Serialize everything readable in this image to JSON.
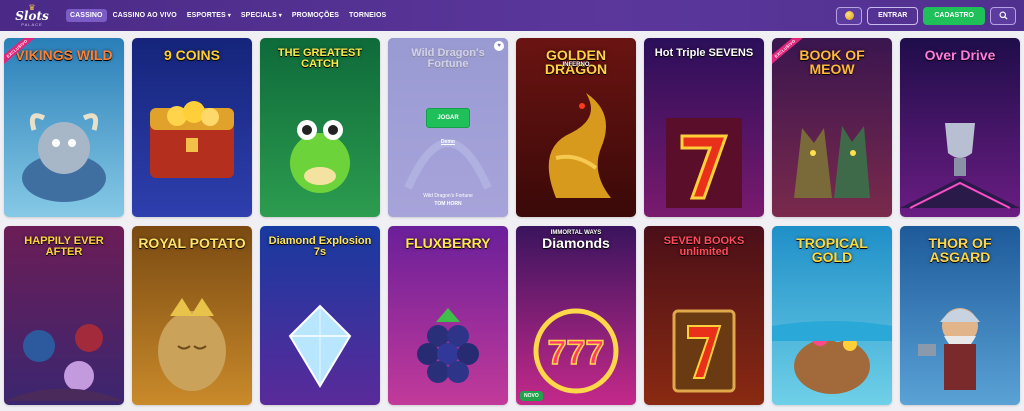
{
  "brand": {
    "name": "Slots",
    "sub": "PALACE"
  },
  "nav": [
    {
      "label": "CASSINO",
      "active": true,
      "dropdown": false
    },
    {
      "label": "CASSINO AO VIVO",
      "active": false,
      "dropdown": false
    },
    {
      "label": "ESPORTES",
      "active": false,
      "dropdown": true
    },
    {
      "label": "SPECIALS",
      "active": false,
      "dropdown": true
    },
    {
      "label": "PROMOÇÕES",
      "active": false,
      "dropdown": false
    },
    {
      "label": "TORNEIOS",
      "active": false,
      "dropdown": false
    }
  ],
  "header": {
    "login_label": "ENTRAR",
    "signup_label": "CADASTRO",
    "chevron": "▾"
  },
  "colors": {
    "accent": "#5b379c",
    "cta": "#1fbf5a",
    "badge_exclusive": "#e0267b"
  },
  "games": [
    {
      "key": "vikings",
      "title": "VIKINGS WILD",
      "title_color": "#ff7e2d",
      "badge": "EXCLUSIVO",
      "bg": [
        "#2a7fb8",
        "#86c9e6"
      ]
    },
    {
      "key": "9coins",
      "title": "9 COINS",
      "title_color": "#ffce2e",
      "badge": "",
      "bg": [
        "#15247a",
        "#2e3fae"
      ]
    },
    {
      "key": "greatest",
      "title": "THE GREATEST CATCH",
      "title_color": "#ffe94a",
      "badge": "",
      "bg": [
        "#0e6a3a",
        "#2c9c4f"
      ]
    },
    {
      "key": "dragons",
      "title": "Wild Dragon's Fortune",
      "title_color": "#ffffff",
      "badge": "",
      "bg": [
        "#3c3faf",
        "#6d60c9"
      ],
      "hover": {
        "play_label": "JOGAR",
        "demo_label": "Demo",
        "game_name": "Wild Dragon's Fortune",
        "provider": "TOM HORN"
      }
    },
    {
      "key": "golden",
      "title": "GOLDEN DRAGON",
      "subtitle": "INFERNO",
      "title_color": "#ffd24a",
      "badge": "",
      "bg": [
        "#6a1412",
        "#3a0908"
      ]
    },
    {
      "key": "sevens",
      "title": "Hot Triple SEVENS",
      "title_color": "#ffffff",
      "badge": "",
      "bg": [
        "#2b0f5a",
        "#7a1a6e"
      ]
    },
    {
      "key": "meow",
      "title": "BOOK OF MEOW",
      "title_color": "#ffb93a",
      "badge": "EXCLUSIVO",
      "bg": [
        "#3a154f",
        "#7a2a4c"
      ]
    },
    {
      "key": "overdrive",
      "title": "Over Drive",
      "title_color": "#ff7be0",
      "badge": "",
      "bg": [
        "#1f0d4a",
        "#6a1d82"
      ]
    },
    {
      "key": "happily",
      "title": "HAPPILY EVER AFTER",
      "title_color": "#ffd23f",
      "badge": "",
      "bg": [
        "#6b1d56",
        "#3b2670"
      ]
    },
    {
      "key": "potato",
      "title": "ROYAL POTATO",
      "title_color": "#ffe36b",
      "badge": "",
      "bg": [
        "#7a4a12",
        "#c98a2a"
      ]
    },
    {
      "key": "diamond",
      "title": "Diamond Explosion 7s",
      "title_color": "#ffe55a",
      "badge": "",
      "bg": [
        "#183aa0",
        "#5a2a9a"
      ]
    },
    {
      "key": "flux",
      "title": "FLUXBERRY",
      "title_color": "#ffe84a",
      "badge": "",
      "bg": [
        "#6a1f9a",
        "#c23a9a"
      ]
    },
    {
      "key": "immortal",
      "title": "Diamonds",
      "subtitle": "IMMORTAL WAYS",
      "title_color": "#ffffff",
      "badge": "",
      "bg": [
        "#3a145e",
        "#c4298a"
      ],
      "new_label": "NOVO"
    },
    {
      "key": "books",
      "title": "SEVEN BOOKS unlimited",
      "title_color": "#ff4b5a",
      "badge": "",
      "bg": [
        "#4a0f18",
        "#8a2a12"
      ]
    },
    {
      "key": "tropical",
      "title": "TROPICAL GOLD",
      "title_color": "#ffd93a",
      "badge": "",
      "bg": [
        "#1f8fc8",
        "#6fd0e8"
      ]
    },
    {
      "key": "thor",
      "title": "THOR OF ASGARD",
      "title_color": "#ffd54a",
      "badge": "",
      "bg": [
        "#1d5a9a",
        "#5aa2d6"
      ]
    }
  ]
}
